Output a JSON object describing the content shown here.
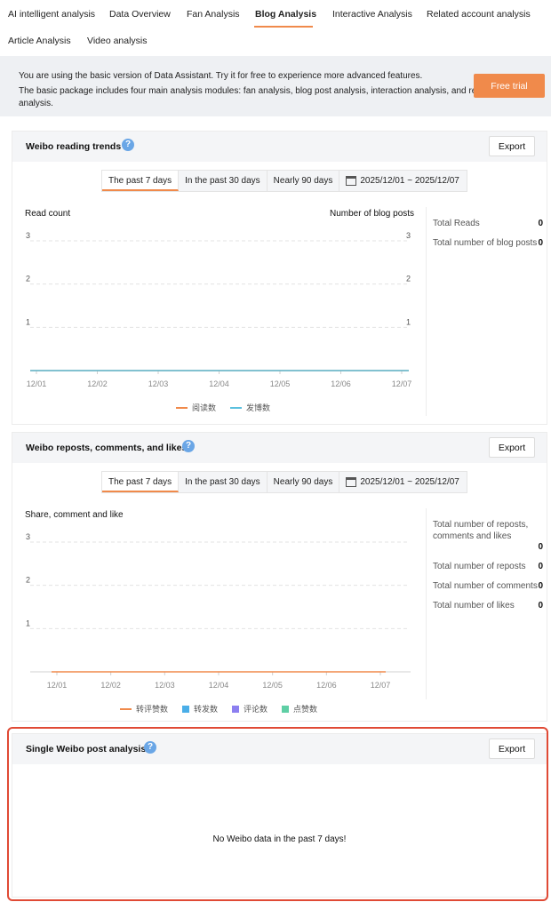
{
  "nav": {
    "tabs": [
      {
        "label": "AI intelligent analysis"
      },
      {
        "label": "Data Overview"
      },
      {
        "label": "Fan Analysis"
      },
      {
        "label": "Blog Analysis"
      },
      {
        "label": "Interactive Analysis"
      },
      {
        "label": "Related account analysis"
      },
      {
        "label": "Article Analysis"
      },
      {
        "label": "Video analysis"
      }
    ],
    "active": "Blog Analysis"
  },
  "banner": {
    "line1": "You are using the basic version of Data Assistant. Try it for free to experience more advanced features.",
    "line2": "The basic package includes four main analysis modules: fan analysis, blog post analysis, interaction analysis, and related account",
    "line3": "analysis.",
    "button": "Free trial"
  },
  "ranges": {
    "opt7": "The past 7 days",
    "opt30": "In the past 30 days",
    "opt90": "Nearly 90 days",
    "date": "2025/12/01 ~ 2025/12/07"
  },
  "reading": {
    "title": "Weibo reading trends",
    "export": "Export",
    "left_label": "Read count",
    "right_label": "Number of blog posts",
    "stats": [
      {
        "label": "Total Reads",
        "value": "0"
      },
      {
        "label": "Total number of blog posts",
        "value": "0"
      }
    ]
  },
  "reposts": {
    "title": "Weibo reposts, comments, and likes",
    "export": "Export",
    "chart_label": "Share, comment and like",
    "stats": [
      {
        "label": "Total number of reposts, comments and likes",
        "value": "0"
      },
      {
        "label": "Total number of reposts",
        "value": "0"
      },
      {
        "label": "Total number of comments",
        "value": "0"
      },
      {
        "label": "Total number of likes",
        "value": "0"
      }
    ]
  },
  "single": {
    "title": "Single Weibo post analysis",
    "export": "Export",
    "empty": "No Weibo data in the past 7 days!"
  },
  "colors": {
    "accent": "#f08a4b",
    "read_series": "#f08a4b",
    "post_series": "#5bc0de",
    "repost_comment_like": "#f08a4b",
    "repost": "#4aaee8",
    "comment": "#8c7ff0",
    "like": "#5fcfa5"
  },
  "chart_data": [
    {
      "type": "line",
      "categories": [
        "12/01",
        "12/02",
        "12/03",
        "12/04",
        "12/05",
        "12/06",
        "12/07"
      ],
      "series": [
        {
          "name": "阅读数",
          "values": [
            0,
            0,
            0,
            0,
            0,
            0,
            0
          ]
        },
        {
          "name": "发博数",
          "values": [
            0,
            0,
            0,
            0,
            0,
            0,
            0
          ]
        }
      ],
      "ylabel": "Read count",
      "y2label": "Number of blog posts",
      "yticks": [
        "1",
        "2",
        "3"
      ],
      "y2ticks": [
        "1",
        "2",
        "3"
      ],
      "ylim": [
        0,
        3
      ],
      "grid": true,
      "legend": "bottom"
    },
    {
      "type": "bar",
      "categories": [
        "12/01",
        "12/02",
        "12/03",
        "12/04",
        "12/05",
        "12/06",
        "12/07"
      ],
      "series": [
        {
          "name": "转评赞数",
          "values": [
            0,
            0,
            0,
            0,
            0,
            0,
            0
          ]
        },
        {
          "name": "转发数",
          "values": [
            0,
            0,
            0,
            0,
            0,
            0,
            0
          ]
        },
        {
          "name": "评论数",
          "values": [
            0,
            0,
            0,
            0,
            0,
            0,
            0
          ]
        },
        {
          "name": "点赞数",
          "values": [
            0,
            0,
            0,
            0,
            0,
            0,
            0
          ]
        }
      ],
      "ylabel": "Share, comment and like",
      "yticks": [
        "1",
        "2",
        "3"
      ],
      "ylim": [
        0,
        3
      ],
      "grid": true,
      "legend": "bottom"
    }
  ]
}
